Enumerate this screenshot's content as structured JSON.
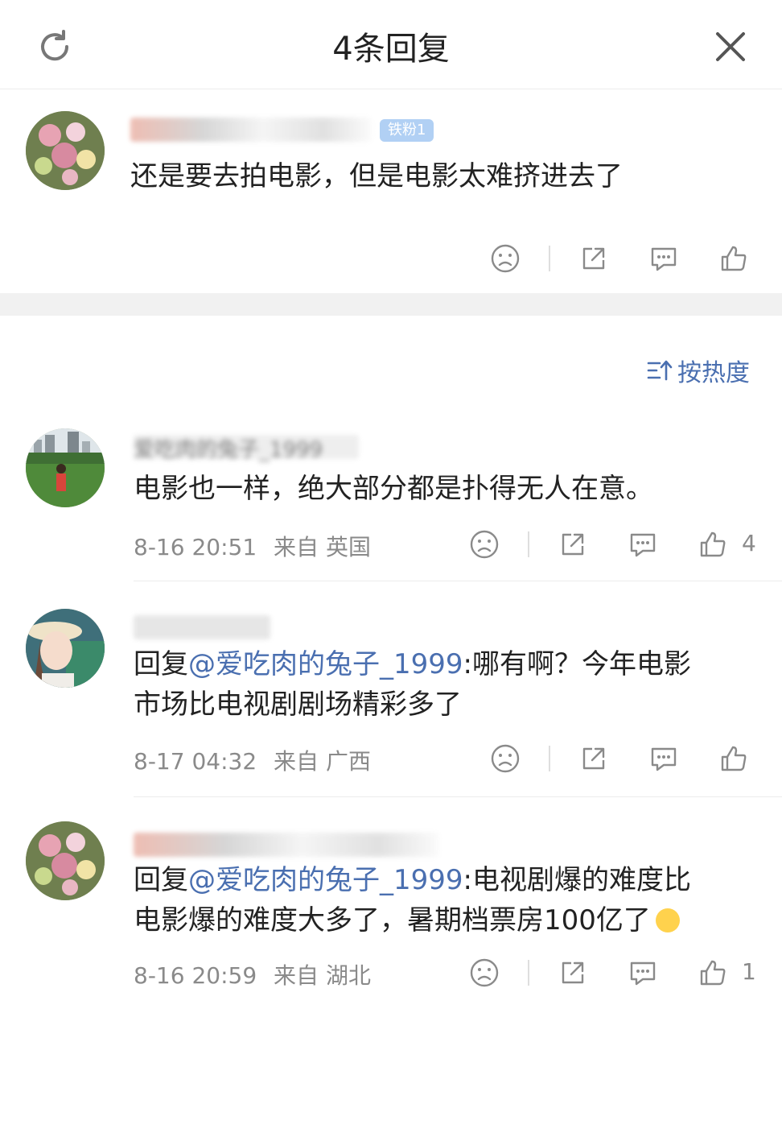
{
  "header": {
    "title": "4条回复"
  },
  "root_comment": {
    "badge": "铁粉1",
    "text": "还是要去拍电影，但是电影太难挤进去了"
  },
  "sort": {
    "label": "按热度"
  },
  "replies": [
    {
      "username": "爱吃肉的兔子_1999",
      "text": "电影也一样，绝大部分都是扑得无人在意。",
      "time": "8-16 20:51",
      "from": "来自",
      "location": "英国",
      "likes": "4"
    },
    {
      "text_prefix": "回复",
      "mention": "@爱吃肉的兔子_1999",
      "text_line1_rest": ":哪有啊？今年电影",
      "text_line2": "市场比电视剧剧场精彩多了",
      "time": "8-17 04:32",
      "from": "来自",
      "location": "广西",
      "likes": ""
    },
    {
      "text_prefix": "回复",
      "mention": "@爱吃肉的兔子_1999",
      "text_line1_rest": ":电视剧爆的难度比",
      "text_line2": "电影爆的难度大多了，暑期档票房100亿了",
      "time": "8-16 20:59",
      "from": "来自",
      "location": "湖北",
      "likes": "1"
    }
  ],
  "colors": {
    "accent": "#4a6fb0",
    "meta": "#8a8a8a",
    "band": "#f1f1f1"
  },
  "icons": [
    "refresh-icon",
    "close-icon",
    "dislike-face-icon",
    "share-icon",
    "comment-icon",
    "like-icon",
    "sort-icon",
    "emoji-icon"
  ]
}
